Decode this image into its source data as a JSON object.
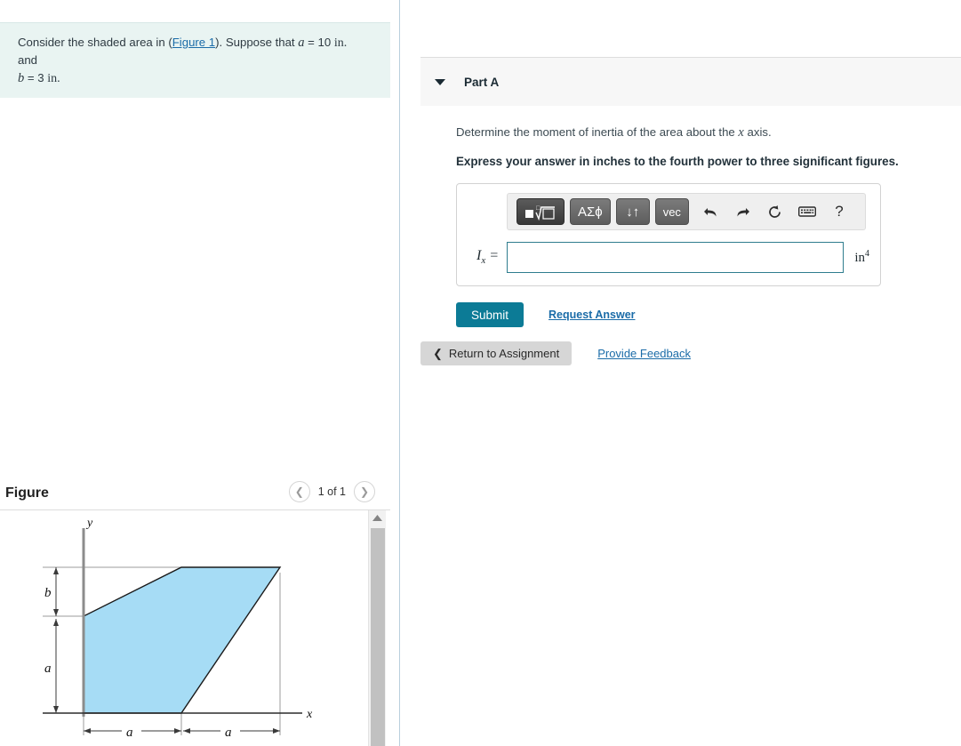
{
  "problem": {
    "text_before_link": "Consider the shaded area in (",
    "link_label": "Figure 1",
    "text_after_link": "). Suppose that ",
    "var_a": "a",
    "eq_a": " = 10 ",
    "unit_a": "in.",
    "conj": " and",
    "var_b": "b",
    "eq_b": " = 3 ",
    "unit_b": "in."
  },
  "part": {
    "title": "Part A",
    "caret_icon": "chevron-down-icon",
    "question_before": "Determine the moment of inertia of the area about the ",
    "question_var": "x",
    "question_after": " axis.",
    "instruction": "Express your answer in inches to the fourth power to three significant figures.",
    "toolbar": {
      "buttons": [
        {
          "name": "math-template-button",
          "label": "■√□",
          "state": "active"
        },
        {
          "name": "greek-symbols-button",
          "label": "ΑΣϕ",
          "state": "normal"
        },
        {
          "name": "updown-arrows-button",
          "label": "↓↑",
          "state": "normal"
        },
        {
          "name": "vector-button",
          "label": "vec",
          "state": "normal"
        }
      ],
      "icons": [
        {
          "name": "undo-icon",
          "glyph": "↶"
        },
        {
          "name": "redo-icon",
          "glyph": "↷"
        },
        {
          "name": "reset-icon",
          "glyph": "↻"
        },
        {
          "name": "keyboard-icon",
          "glyph": "⌨"
        },
        {
          "name": "help-icon",
          "glyph": "?"
        }
      ]
    },
    "answer_label_main": "I",
    "answer_label_sub": "x",
    "answer_label_eq": " =",
    "answer_value": "",
    "answer_placeholder": "",
    "unit_main": "in",
    "unit_sup": "4",
    "submit_label": "Submit",
    "request_answer_label": "Request Answer"
  },
  "footer": {
    "return_label": "Return to Assignment",
    "return_icon": "chevron-left-icon",
    "feedback_label": "Provide Feedback"
  },
  "figure": {
    "title": "Figure",
    "pager_prev_icon": "chevron-left-icon",
    "pager_next_icon": "chevron-right-icon",
    "pager_label": "1 of 1",
    "scroll_up_icon": "caret-up-icon",
    "diagram": {
      "axis_y_label": "y",
      "axis_x_label": "x",
      "dim_b_label": "b",
      "dim_a_vertical_label": "a",
      "dim_a_left_label": "a",
      "dim_a_right_label": "a",
      "shaded_fill": "#a6dcf5",
      "outline_color": "#1a1a1a",
      "axis_color": "#8c8c8c",
      "vertices_description": "(0,0), (a,0), (2a,a+b), (a,a+b), (0,a)"
    }
  },
  "colors": {
    "problem_box_bg": "#e9f4f2",
    "panel_header_bg": "#f7f7f7",
    "submit_bg": "#0c7b96",
    "link_blue": "#1b6ca8",
    "input_border": "#2f7d8e",
    "return_bg": "#d6d6d6",
    "shape_blue": "#a6dcf5"
  }
}
